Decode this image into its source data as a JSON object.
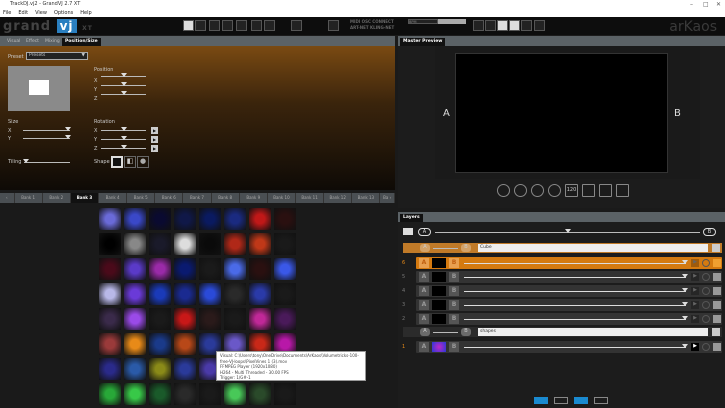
{
  "window": {
    "title": "TrackDJ.vj2 - GrandVJ 2.7 XT",
    "controls": [
      "–",
      "□",
      "✕"
    ]
  },
  "menu": [
    "File",
    "Edit",
    "View",
    "Options",
    "Help"
  ],
  "toolbar": {
    "logo": "grand",
    "logo_vj": "vj",
    "logo_ed": "XT",
    "brand": "arKaos",
    "midi_line1": "MIDI OSC CONNECT",
    "midi_line2": "ART-NET KLING-NET",
    "bpm_label": "BPM",
    "icons": [
      "list-view-icon",
      "grid-view-icon",
      "crossfade-icon",
      "crossfade2-icon",
      "brush-icon",
      "close-icon",
      "fullscreen-icon",
      "mic-icon",
      "speaker-icon",
      "layout1-icon",
      "layout2-icon",
      "layout3-icon",
      "filter-icon",
      "chart-icon",
      "k-icon"
    ]
  },
  "left_tabs": [
    "Visual",
    "Effect",
    "Mixing",
    "Position/Size"
  ],
  "position_size": {
    "preset_label": "Preset",
    "preset_value": "Presets",
    "position_label": "Position",
    "rotation_label": "Rotation",
    "size_label": "Size",
    "tiling_label": "Tiling",
    "shape_label": "Shape",
    "x": "X",
    "y": "Y",
    "z": "Z"
  },
  "banks": [
    "‹",
    "Bank 1",
    "Bank 2",
    "Bank 3",
    "Bank 4",
    "Bank 5",
    "Bank 6",
    "Bank 7",
    "Bank 8",
    "Bank 9",
    "Bank 10",
    "Bank 11",
    "Bank 12",
    "Bank 13",
    "Ba ›"
  ],
  "active_bank": "Bank 3",
  "clips": [
    "#6a6ad8",
    "#3a48c8",
    "#0a0a30",
    "#101848",
    "#0a1a60",
    "#1a2a80",
    "#c01818",
    "#2a1010",
    "#000000",
    "#888888",
    "#1a1a2a",
    "#dddddd",
    "#0a0a0a",
    "#b02818",
    "#c03818",
    "#1a1a1a",
    "#4a0a1a",
    "#5a3ac8",
    "#9a2aa8",
    "#0a1a70",
    "#1a1a1a",
    "#4a6ae8",
    "#2a1010",
    "#3a58e8",
    "#b8b8e8",
    "#6a3ad8",
    "#1a3ab8",
    "#1a2a90",
    "#2a4ad8",
    "#2a2a2a",
    "#2a3aa8",
    "#1a1a1a",
    "#3a2a4a",
    "#9a4ae8",
    "#1a1a1a",
    "#c81818",
    "#2a1a1a",
    "#1a1a1a",
    "#c02898",
    "#4a1a5a",
    "#9a3a3a",
    "#e88a18",
    "#1a3a8a",
    "#b84818",
    "#2a3a9a",
    "#6a58c8",
    "#c82818",
    "#b818a8",
    "#2a2a8a",
    "#2a5aa8",
    "#8a8a18",
    "#2a3a9a",
    "#4a3aa8",
    "#2a2a2a",
    "#c8a818",
    "#b81838",
    "#28a838",
    "#38c848",
    "#1a5a2a",
    "#2a2a2a",
    "#1a1a1a",
    "#48c858",
    "#2a4a2a",
    "#1a1a1a"
  ],
  "tooltip": [
    "Visual: C:\\Users\\tony\\OneDrive\\Documents\\ArKaos\\Volumetricks-100-",
    "free-VJ-loops\\PixelVines 1 (3).mov",
    "FFMPEG Player (1920x1080)",
    "H264 - Multi Threaded - 30.00 FPS",
    "Trigger: 1/G#-1"
  ],
  "master": {
    "tab": "Master Preview",
    "a": "A",
    "b": "B",
    "fx": [
      "dial-icon",
      "brightness-icon",
      "rotate-icon",
      "contrast-icon",
      "120",
      "waveform-icon",
      "screen-icon",
      "pencil-icon"
    ],
    "fx_120": "120"
  },
  "layers": {
    "tab": "Layers",
    "a": "A",
    "b": "B",
    "groups": [
      {
        "name": "Cube",
        "color": "#c07a28",
        "rows": [
          {
            "n": "6",
            "active": true,
            "color": "#d47a10"
          },
          {
            "n": "5"
          },
          {
            "n": "4"
          },
          {
            "n": "3"
          },
          {
            "n": "2"
          }
        ]
      },
      {
        "name": "shapes",
        "color": "#2b2b2b",
        "rows": [
          {
            "n": "1",
            "clip": true
          }
        ]
      }
    ]
  },
  "bottom_buttons": [
    "lightning-icon",
    "toggle-icon",
    "arrow-icon",
    "loop-icon"
  ]
}
